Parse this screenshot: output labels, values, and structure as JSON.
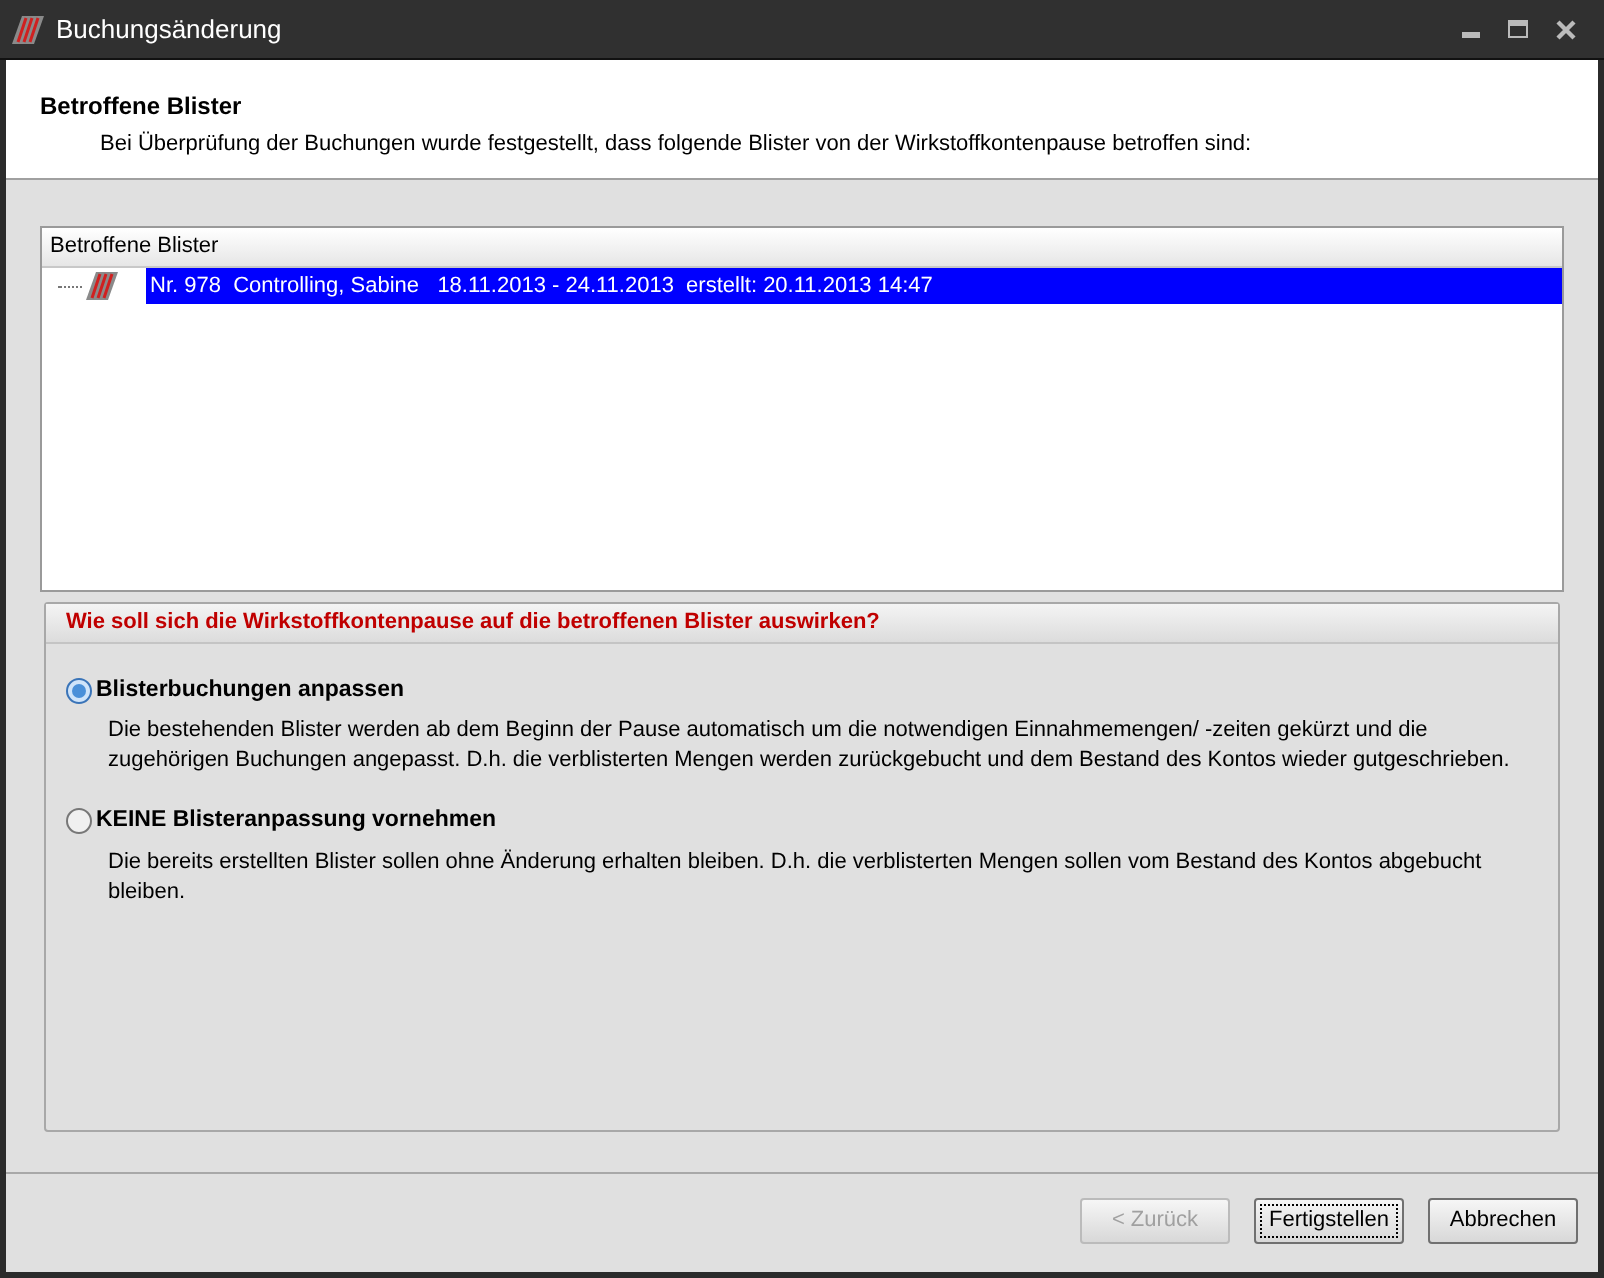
{
  "window": {
    "title": "Buchungsänderung"
  },
  "header": {
    "title": "Betroffene Blister",
    "subtitle": "Bei Überprüfung der Buchungen wurde festgestellt, dass folgende Blister von der Wirkstoffkontenpause betroffen sind:"
  },
  "list": {
    "column": "Betroffene Blister",
    "rows": [
      {
        "text": "Nr. 978  Controlling, Sabine   18.11.2013 - 24.11.2013  erstellt: 20.11.2013 14:47",
        "selected": true
      }
    ]
  },
  "group": {
    "title": "Wie soll sich die Wirkstoffkontenpause auf die betroffenen Blister auswirken?",
    "options": [
      {
        "label": "Blisterbuchungen anpassen",
        "description": "Die bestehenden Blister werden ab dem Beginn der Pause automatisch um die notwendigen Einnahmemengen/ -zeiten gekürzt und die zugehörigen Buchungen angepasst. D.h. die verblisterten Mengen werden zurückgebucht und dem Bestand des Kontos wieder gutgeschrieben.",
        "selected": true
      },
      {
        "label": "KEINE Blisteranpassung vornehmen",
        "description": "Die bereits erstellten Blister sollen ohne Änderung erhalten bleiben. D.h. die verblisterten Mengen sollen vom Bestand des Kontos abgebucht bleiben.",
        "selected": false
      }
    ]
  },
  "buttons": [
    {
      "label": "< Zurück",
      "disabled": true,
      "focused": false
    },
    {
      "label": "Fertigstellen",
      "disabled": false,
      "focused": true
    },
    {
      "label": "Abbrechen",
      "disabled": false,
      "focused": false
    }
  ]
}
